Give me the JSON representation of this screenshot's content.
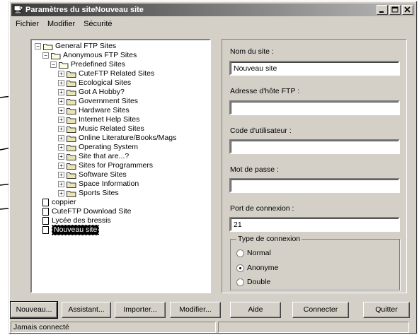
{
  "window": {
    "title": "Paramètres du siteNouveau site",
    "controls": [
      "minimize-icon",
      "maximize-icon",
      "close-icon"
    ]
  },
  "menu": [
    {
      "label": "Fichier"
    },
    {
      "label": "Modifier"
    },
    {
      "label": "Sécurité"
    }
  ],
  "tree": {
    "root": "General FTP Sites",
    "anon": "Anonymous FTP Sites",
    "predef": "Predefined Sites",
    "categories": [
      "CuteFTP Related Sites",
      "Ecological Sites",
      "Got A Hobby?",
      "Government Sites",
      "Hardware Sites",
      "Internet Help Sites",
      "Music Related Sites",
      "Online Literature/Books/Mags",
      "Operating System",
      "Site that are...?",
      "Sites for Programmers",
      "Software Sites",
      "Space Information",
      "Sports Sites"
    ],
    "sites": [
      "coppier",
      "CuteFTP Download Site",
      "Lycée des bressis"
    ],
    "selected": "Nouveau site"
  },
  "form": {
    "site_name_label": "Nom du site :",
    "site_name_value": "Nouveau site",
    "host_label": "Adresse d'hôte FTP :",
    "host_value": "",
    "user_label": "Code d'utilisateur :",
    "user_value": "",
    "password_label": "Mot de passe :",
    "password_value": "",
    "port_label": "Port de connexion :",
    "port_value": "21",
    "conn_type_title": "Type de connexion",
    "options": [
      {
        "label": "Normal",
        "selected": false
      },
      {
        "label": "Anonyme",
        "selected": true
      },
      {
        "label": "Double",
        "selected": false
      }
    ]
  },
  "buttons": {
    "new": "Nouveau...",
    "wizard": "Assistant...",
    "import": "Importer...",
    "edit": "Modifier...",
    "help": "Aide",
    "connect": "Connecter",
    "quit": "Quitter"
  },
  "status": {
    "text": "Jamais connecté"
  }
}
